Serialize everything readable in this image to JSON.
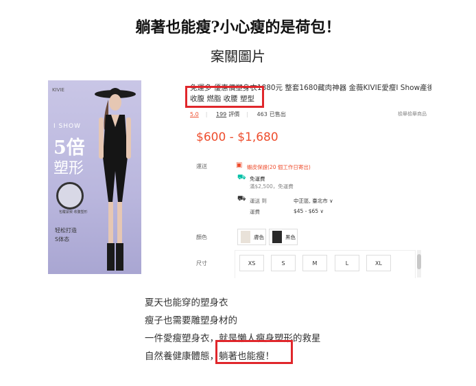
{
  "title": "躺著也能瘦?小心瘦的是荷包！",
  "subtitle": "案關圖片",
  "product_image": {
    "brand": "KIVIE",
    "line1": "I SHOW",
    "line2": "5倍",
    "line3": "塑形",
    "caption_small": "包覆紧致·收腹塑形",
    "slogan1": "轻松打造",
    "slogan2": "S体态"
  },
  "product": {
    "name_line1": "免運多 優惠價塑身衣1880元 整套1680藏肉神器 金薇KIVIE愛瘦I Show產後",
    "name_line2": "收腹 燃脂 收腰 塑型",
    "rating": "5.0",
    "reviews_count": "199",
    "reviews_label": "評價",
    "sold_count": "463",
    "sold_label": "已售出",
    "report": "檢舉檢舉商品",
    "price": "$600 - $1,680",
    "shipping_label": "運送",
    "shipping_guarantee": "蝦皮保證(20 個工作日寄出)",
    "free_shipping": "免運費",
    "free_shipping_note": "滿$2,500，免運費",
    "ship_to_label": "運送 到",
    "ship_to_value": "中正區, 臺北市",
    "fee_label": "運費",
    "fee_value": "$45 - $65",
    "color_label": "顏色",
    "colors": [
      "膚色",
      "黑色"
    ],
    "size_label": "尺寸",
    "sizes": [
      "XS",
      "S",
      "M",
      "L",
      "XL"
    ]
  },
  "caption": {
    "line1": "夏天也能穿的塑身衣",
    "line2": "瘦子也需要雕塑身材的",
    "line3": "一件愛瘦塑身衣，就是懶人瘦身塑形的救星",
    "line4_a": "自然養健康體態，",
    "line4_b": "躺著也能瘦！"
  },
  "colors": {
    "accent_red": "#e0262b",
    "price_orange": "#ee4d2d"
  }
}
